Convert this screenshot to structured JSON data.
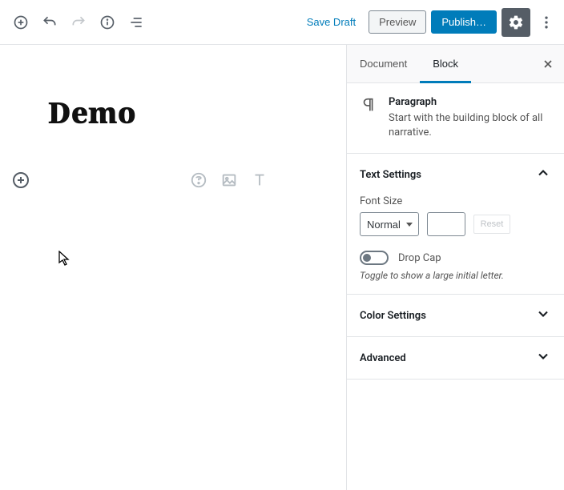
{
  "topbar": {
    "save_draft": "Save Draft",
    "preview": "Preview",
    "publish": "Publish…"
  },
  "editor": {
    "title": "Demo"
  },
  "sidebar": {
    "tabs": {
      "document": "Document",
      "block": "Block"
    },
    "block_info": {
      "title": "Paragraph",
      "desc": "Start with the building block of all narrative."
    },
    "text_settings": {
      "title": "Text Settings",
      "font_size_label": "Font Size",
      "font_size_value": "Normal",
      "reset": "Reset",
      "drop_cap_label": "Drop Cap",
      "drop_cap_help": "Toggle to show a large initial letter."
    },
    "color_settings": {
      "title": "Color Settings"
    },
    "advanced": {
      "title": "Advanced"
    }
  }
}
